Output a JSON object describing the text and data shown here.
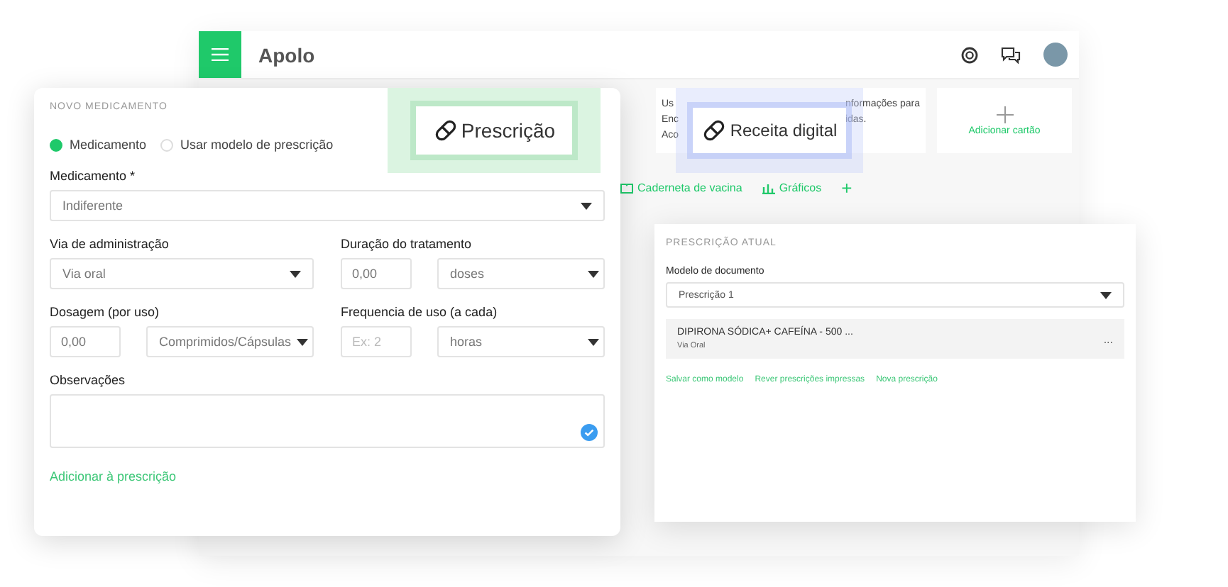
{
  "header": {
    "app_name": "Apolo"
  },
  "background_cards": [
    {
      "left_lines": [
        "Us",
        "Enc",
        "Aco"
      ],
      "right_lines": [
        "nformações para",
        "idas."
      ]
    }
  ],
  "add_card": {
    "label": "Adicionar cartão"
  },
  "tab_links": [
    {
      "label": "Caderneta de vacina"
    },
    {
      "label": "Gráficos"
    },
    {
      "label": "+"
    }
  ],
  "callouts": [
    {
      "label": "Prescrição",
      "kind": "green"
    },
    {
      "label": "Receita digital",
      "kind": "blue"
    }
  ],
  "new_medication": {
    "title": "NOVO MEDICAMENTO",
    "radios": [
      {
        "label": "Medicamento",
        "selected": true
      },
      {
        "label": "Usar modelo de prescrição",
        "selected": false
      }
    ],
    "medication": {
      "label": "Medicamento *",
      "value": "Indiferente"
    },
    "route": {
      "label": "Via de administração",
      "value": "Via oral"
    },
    "duration": {
      "label": "Duração do tratamento",
      "value": "0,00",
      "unit": "doses"
    },
    "dosage": {
      "label": "Dosagem (por uso)",
      "value": "0,00",
      "unit": "Comprimidos/Cápsulas"
    },
    "frequency": {
      "label": "Frequencia de uso (a cada)",
      "placeholder": "Ex: 2",
      "unit": "horas"
    },
    "notes": {
      "label": "Observações"
    },
    "add_link": "Adicionar à prescrição"
  },
  "current_prescription": {
    "title": "PRESCRIÇÃO ATUAL",
    "model_label": "Modelo de documento",
    "model_value": "Prescrição 1",
    "items": [
      {
        "name": "DIPIRONA SÓDICA+ CAFEÍNA - 500 ...",
        "route": "Via Oral",
        "menu": "..."
      }
    ],
    "links": [
      "Salvar como modelo",
      "Rever prescrições impressas",
      "Nova prescrição"
    ]
  }
}
